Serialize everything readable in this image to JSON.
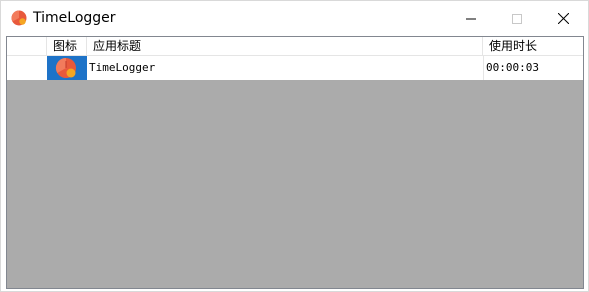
{
  "window": {
    "title": "TimeLogger",
    "app_icon": "clock-pie-icon"
  },
  "controls": {
    "minimize_icon": "minimize-icon",
    "maximize_icon": "maximize-icon",
    "close_icon": "close-icon"
  },
  "table": {
    "columns": [
      "",
      "图标",
      "应用标题",
      "使用时长"
    ],
    "rows": [
      {
        "index": "",
        "icon": "clock-pie-icon",
        "app_title": "TimeLogger",
        "duration": "00:00:03"
      }
    ]
  },
  "colors": {
    "selected_icon_bg": "#1e73c8",
    "empty_area": "#ababab",
    "icon_red": "#e8593c",
    "icon_orange": "#f5a623"
  }
}
